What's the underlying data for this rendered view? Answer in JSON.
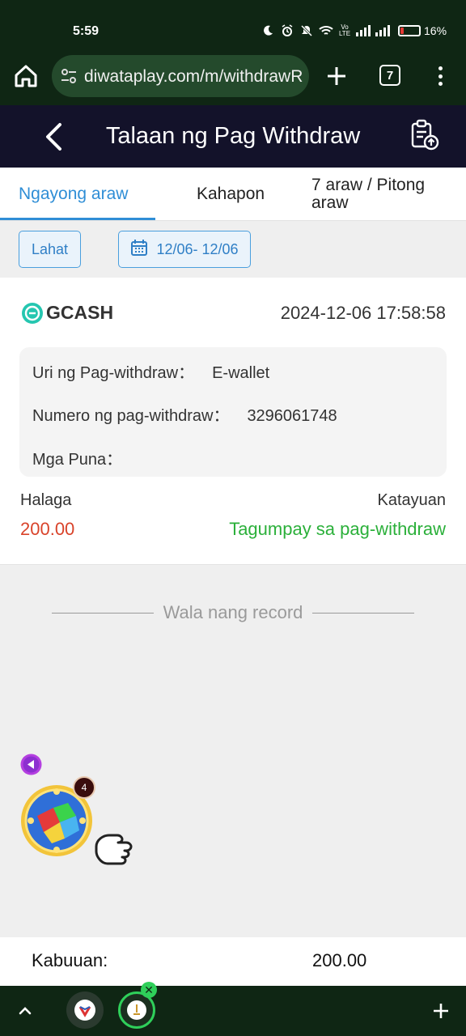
{
  "status_bar": {
    "time": "5:59",
    "volte_label": "Vo LTE",
    "battery_percent": "16%",
    "battery_level": 0.16,
    "battery_color": "#e53935"
  },
  "browser": {
    "url": "diwataplay.com/m/withdrawR",
    "tab_count": "7",
    "icons": [
      "home-icon",
      "site-settings-icon",
      "plus-icon",
      "tab-switcher-icon",
      "more-vert-icon"
    ]
  },
  "header": {
    "title": "Talaan ng Pag Withdraw",
    "icons": [
      "back-arrow-icon",
      "clipboard-export-icon"
    ]
  },
  "tabs": [
    {
      "label": "Ngayong araw",
      "active": true
    },
    {
      "label": "Kahapon",
      "active": false
    },
    {
      "label_line1": "7 araw / Pitong",
      "label_line2": "araw",
      "active": false
    }
  ],
  "filters": {
    "all_label": "Lahat",
    "date_range": "12/06- 12/06"
  },
  "record": {
    "method": "GCASH",
    "datetime": "2024-12-06 17:58:58",
    "type_label": "Uri ng Pag-withdraw：",
    "type_value": "E-wallet",
    "number_label": "Numero ng pag-withdraw：",
    "number_value": "3296061748",
    "remarks_label": "Mga Puna：",
    "remarks_value": "",
    "amount_label": "Halaga",
    "amount_value": "200.00",
    "status_label": "Katayuan",
    "status_value": "Tagumpay sa pag-withdraw"
  },
  "empty_text": "Wala nang record",
  "widget": {
    "badge_count": "4"
  },
  "total": {
    "label": "Kabuuan:",
    "value": "200.00"
  },
  "colors": {
    "accent": "#2f8ed6",
    "amount": "#d9432a",
    "success": "#2bb03a",
    "header_bg": "#13122a",
    "browser_bg": "#0f2614"
  }
}
